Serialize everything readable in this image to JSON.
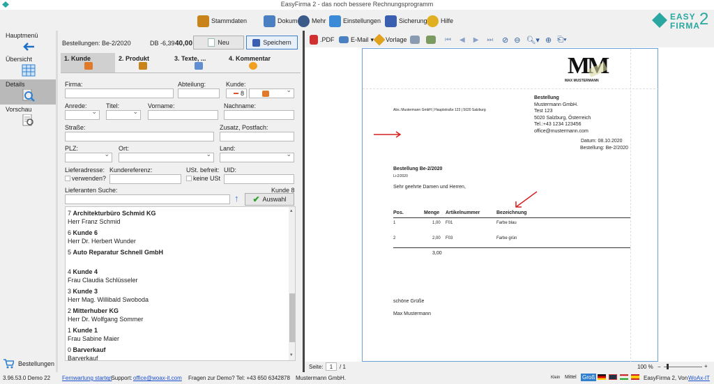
{
  "window": {
    "title": "EasyFirma 2 - das noch bessere Rechnungsprogramm"
  },
  "toolbar": [
    {
      "label": "Stammdaten",
      "icon": "cart-icon",
      "color": "#c8841a"
    },
    {
      "label": "Dokumente",
      "icon": "documents-icon",
      "color": "#4a7fc1"
    },
    {
      "label": "Mehr",
      "icon": "more-icon",
      "color": "#3a5a8a"
    },
    {
      "label": "Einstellungen",
      "icon": "gears-icon",
      "color": "#3a8ad8"
    },
    {
      "label": "Sicherung",
      "icon": "save-icon",
      "color": "#3a5fb0"
    },
    {
      "label": "Hilfe",
      "icon": "help-icon",
      "color": "#e0b020"
    }
  ],
  "brand": {
    "line1": "EASY",
    "line2": "FIRMA",
    "number": "2",
    "color": "#2aa7a0"
  },
  "sidebar": {
    "items": [
      {
        "label": "Hauptmenü",
        "icon": "arrow-left-icon"
      },
      {
        "label": "Übersicht",
        "icon": "grid-icon"
      },
      {
        "label": "Details",
        "icon": "magnifier-icon"
      },
      {
        "label": "Vorschau",
        "icon": "preview-icon"
      }
    ],
    "bottom": "Bestellungen"
  },
  "form": {
    "doc": "Bestellungen: Be-2/2020",
    "db_label": "DB -6,39",
    "db_value": "40,00",
    "new_label": "Neu",
    "save_label": "Speichern",
    "tabs": [
      "1. Kunde",
      "2. Produkt",
      "3. Texte, ...",
      "4. Kommentar"
    ],
    "firma": "Firma:",
    "abteilung": "Abteilung:",
    "kunde": "Kunde:",
    "kunde_nr": "8",
    "anrede": "Anrede:",
    "titel": "Titel:",
    "vorname": "Vorname:",
    "nachname": "Nachname:",
    "strasse": "Straße:",
    "zusatz": "Zusatz, Postfach:",
    "plz": "PLZ:",
    "ort": "Ort:",
    "land": "Land:",
    "liefer": "Lieferadresse:",
    "kundenref": "Kundereferenz:",
    "ust": "USt. befreit:",
    "uid": "UID:",
    "verwenden": "verwenden?",
    "keine_ust": "keine USt",
    "liefer_suche": "Lieferanten Suche:",
    "kunde_count": "Kunde 8",
    "auswahl": "Auswahl"
  },
  "customers": [
    {
      "no": "7",
      "name": "Architekturbüro Schmid KG",
      "contact": "Herr Franz Schmid"
    },
    {
      "no": "6",
      "name": "Kunde 6",
      "contact": "Herr Dr. Herbert Wunder"
    },
    {
      "no": "5",
      "name": "Auto Reparatur Schnell GmbH",
      "contact": ""
    },
    {
      "no": "4",
      "name": "Kunde 4",
      "contact": "Frau Claudia Schlüsseler"
    },
    {
      "no": "3",
      "name": "Kunde 3",
      "contact": "Herr Mag. Willibald Swoboda"
    },
    {
      "no": "2",
      "name": "Mitterhuber KG",
      "contact": "Herr Dr. Wolfgang Sommer"
    },
    {
      "no": "1",
      "name": "Kunde 1",
      "contact": "Frau Sabine Maier"
    },
    {
      "no": "0",
      "name": "Barverkauf",
      "contact": "Barverkauf"
    }
  ],
  "preview": {
    "tools": {
      "pdf": ".PDF",
      "email": "E-Mail",
      "vorlage": "Vorlage"
    },
    "logo": "MM",
    "logo_sub": "MAX MUSTERMANN",
    "sender_line": "Abs.:Mustermann GmbH | Hauptstraße 123 | 5020 Salzburg",
    "block": [
      "Bestellung",
      "Mustermann GmbH.",
      "Test 123",
      "5020 Salzburg, Österreich",
      "Tel.:+43 1234 123456",
      "office@mustermann.com"
    ],
    "datum": "Datum: 08.10.2020",
    "bestellung": "Bestellung: Be-2/2020",
    "heading": "Bestellung Be-2/2020",
    "sub": "Li-2/2020",
    "greeting": "Sehr geehrte Damen und Herren,",
    "cols": [
      "Pos.",
      "Menge",
      "Artikelnummer",
      "Bezeichnung"
    ],
    "rows": [
      [
        "1",
        "1,00",
        "F01",
        "Farbe blau"
      ],
      [
        "2",
        "2,00",
        "F03",
        "Farbe grün"
      ]
    ],
    "total": "3,00",
    "closing": "schöne Grüße",
    "signature": "Max Mustermann",
    "page_label": "Seite:",
    "page": "1",
    "pages": "/ 1",
    "zoom": "100 %",
    "arrow_color": "#d42020"
  },
  "status": {
    "version": "3.96.53.0 Demo 22",
    "fernwartung": "Fernwartung starten",
    "support": ", Support:",
    "email": "office@woax-it.com",
    "fragen": "Fragen zur Demo? Tel: +43 650 6342878",
    "company": "Mustermann GmbH.",
    "klein": "Klein",
    "mittel": "Mittel",
    "gross": "Groß",
    "app": "EasyFirma 2, Von",
    "vendor": "WoAx-IT"
  }
}
